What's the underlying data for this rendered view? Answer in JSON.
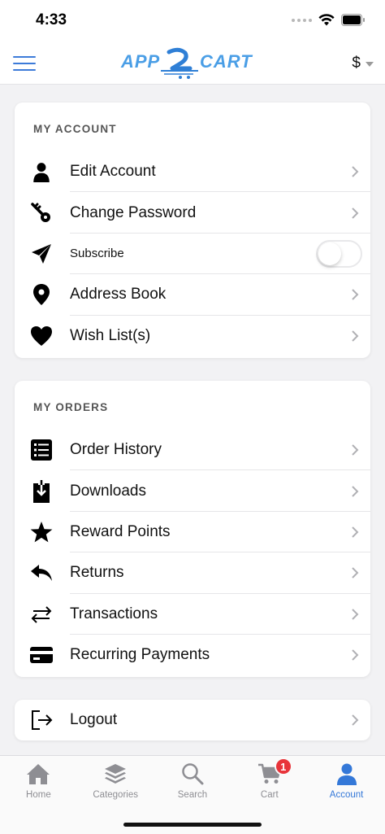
{
  "status_bar": {
    "time": "4:33"
  },
  "header": {
    "logo_text": "APP2CART",
    "currency": "$"
  },
  "my_account": {
    "title": "MY ACCOUNT",
    "items": [
      {
        "label": "Edit Account",
        "icon": "person-icon"
      },
      {
        "label": "Change Password",
        "icon": "key-icon"
      },
      {
        "label": "Subscribe",
        "icon": "paper-plane-icon",
        "toggle_on": false
      },
      {
        "label": "Address Book",
        "icon": "location-pin-icon"
      },
      {
        "label": "Wish List(s)",
        "icon": "heart-icon"
      }
    ]
  },
  "my_orders": {
    "title": "MY ORDERS",
    "items": [
      {
        "label": "Order History",
        "icon": "list-icon"
      },
      {
        "label": "Downloads",
        "icon": "download-icon"
      },
      {
        "label": "Reward Points",
        "icon": "star-icon"
      },
      {
        "label": "Returns",
        "icon": "reply-icon"
      },
      {
        "label": "Transactions",
        "icon": "swap-arrows-icon"
      },
      {
        "label": "Recurring Payments",
        "icon": "credit-card-icon"
      }
    ]
  },
  "logout": {
    "label": "Logout",
    "icon": "logout-icon"
  },
  "tabs": [
    {
      "label": "Home",
      "icon": "home-icon",
      "active": false
    },
    {
      "label": "Categories",
      "icon": "layers-icon",
      "active": false
    },
    {
      "label": "Search",
      "icon": "search-icon",
      "active": false
    },
    {
      "label": "Cart",
      "icon": "cart-icon",
      "active": false,
      "badge": "1"
    },
    {
      "label": "Account",
      "icon": "account-icon",
      "active": true
    }
  ],
  "colors": {
    "accent": "#3478d8",
    "logo_blue": "#4a9ee6",
    "badge_red": "#e8343a"
  }
}
